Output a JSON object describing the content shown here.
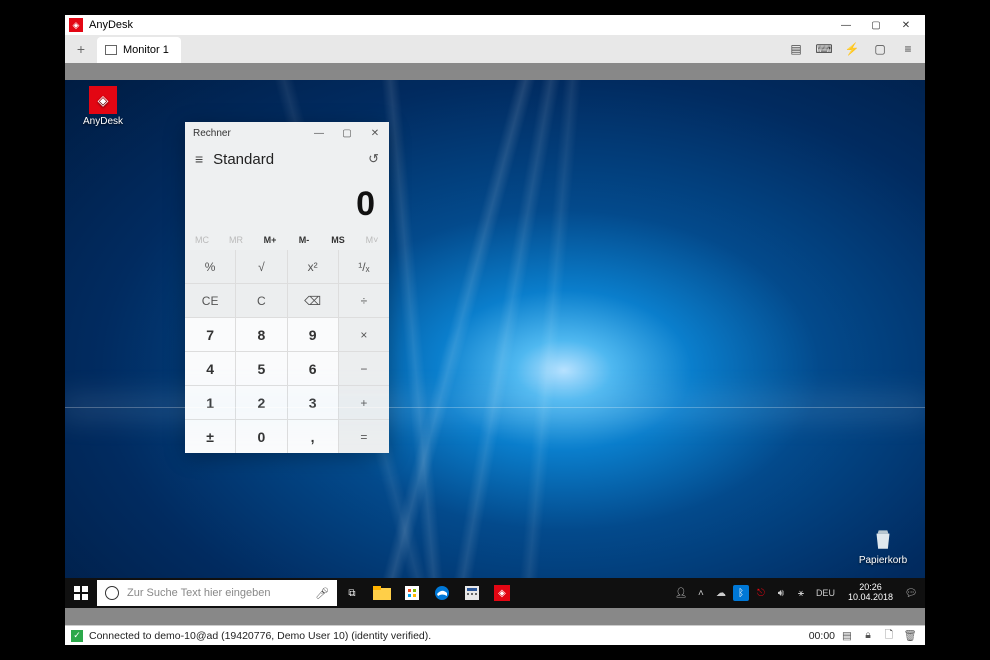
{
  "window": {
    "title": "AnyDesk",
    "tab_label": "Monitor 1"
  },
  "desktop": {
    "anydesk_label": "AnyDesk",
    "recycle_label": "Papierkorb"
  },
  "calculator": {
    "title": "Rechner",
    "mode": "Standard",
    "display": "0",
    "memory": [
      "MC",
      "MR",
      "M+",
      "M-",
      "MS",
      "M˅"
    ],
    "buttons": [
      {
        "label": "%",
        "kind": "fn"
      },
      {
        "label": "√",
        "kind": "fn"
      },
      {
        "label": "x²",
        "kind": "fn"
      },
      {
        "label": "¹/ₓ",
        "kind": "fn"
      },
      {
        "label": "CE",
        "kind": "fn"
      },
      {
        "label": "C",
        "kind": "fn"
      },
      {
        "label": "⌫",
        "kind": "fn"
      },
      {
        "label": "÷",
        "kind": "fn"
      },
      {
        "label": "7",
        "kind": "num"
      },
      {
        "label": "8",
        "kind": "num"
      },
      {
        "label": "9",
        "kind": "num"
      },
      {
        "label": "×",
        "kind": "fn"
      },
      {
        "label": "4",
        "kind": "num"
      },
      {
        "label": "5",
        "kind": "num"
      },
      {
        "label": "6",
        "kind": "num"
      },
      {
        "label": "−",
        "kind": "fn"
      },
      {
        "label": "1",
        "kind": "num"
      },
      {
        "label": "2",
        "kind": "num"
      },
      {
        "label": "3",
        "kind": "num"
      },
      {
        "label": "+",
        "kind": "fn"
      },
      {
        "label": "±",
        "kind": "num"
      },
      {
        "label": "0",
        "kind": "num"
      },
      {
        "label": ",",
        "kind": "num"
      },
      {
        "label": "=",
        "kind": "fn"
      }
    ]
  },
  "taskbar": {
    "search_placeholder": "Zur Suche Text hier eingeben",
    "language": "DEU",
    "time": "20:26",
    "date": "10.04.2018"
  },
  "status": {
    "text": "Connected to demo-10@ad (19420776, Demo User 10) (identity verified).",
    "elapsed": "00:00"
  }
}
